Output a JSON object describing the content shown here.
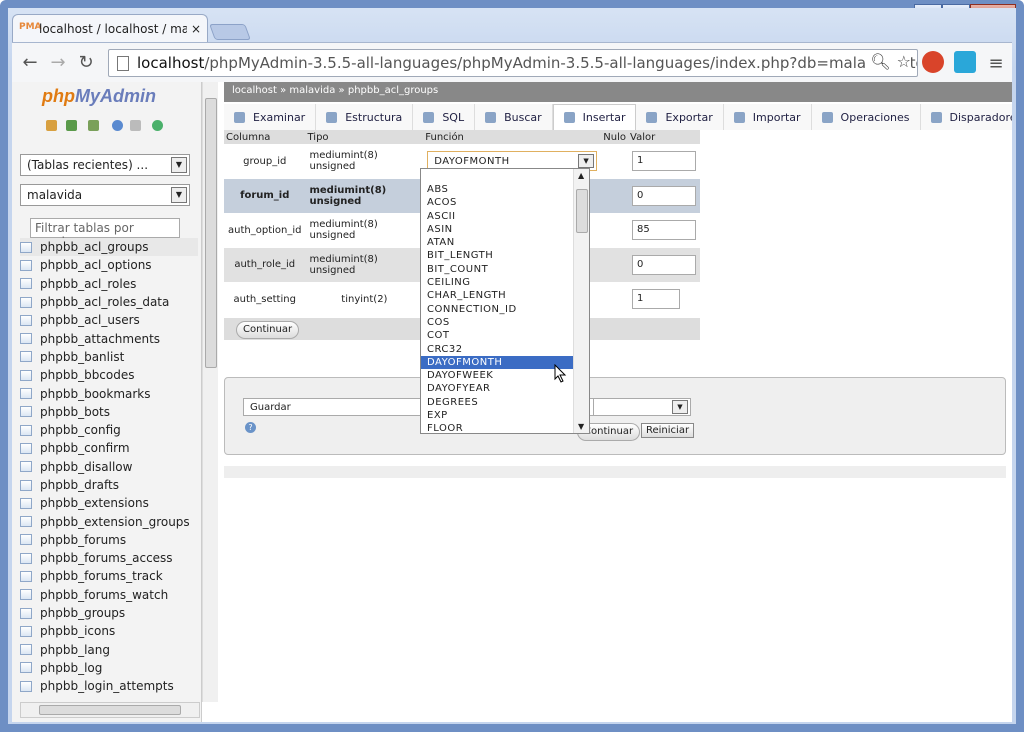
{
  "browser": {
    "tab_title": "localhost / localhost / mal",
    "tab_icon_text": "PMA",
    "close_glyph": "×",
    "url_host": "localhost",
    "url_path": "/phpMyAdmin-3.5.5-all-languages/phpMyAdmin-3.5.5-all-languages/index.php?db=malavida&tok",
    "caption_min": "‒",
    "caption_max": "□",
    "caption_close": "✕",
    "back": "←",
    "forward": "→",
    "reload": "↻",
    "zoom_icon": "🔍︎",
    "star_icon": "☆",
    "menu_icon": "≡"
  },
  "sidebar": {
    "logo_a": "php",
    "logo_b": "MyAdmin",
    "recent_select": "(Tablas recientes) ...",
    "db_select": "malavida",
    "filter_placeholder": "Filtrar tablas por nombre",
    "tables": [
      "phpbb_acl_groups",
      "phpbb_acl_options",
      "phpbb_acl_roles",
      "phpbb_acl_roles_data",
      "phpbb_acl_users",
      "phpbb_attachments",
      "phpbb_banlist",
      "phpbb_bbcodes",
      "phpbb_bookmarks",
      "phpbb_bots",
      "phpbb_config",
      "phpbb_confirm",
      "phpbb_disallow",
      "phpbb_drafts",
      "phpbb_extensions",
      "phpbb_extension_groups",
      "phpbb_forums",
      "phpbb_forums_access",
      "phpbb_forums_track",
      "phpbb_forums_watch",
      "phpbb_groups",
      "phpbb_icons",
      "phpbb_lang",
      "phpbb_log",
      "phpbb_login_attempts"
    ]
  },
  "breadcrumb": {
    "server": "localhost",
    "db": "malavida",
    "table": "phpbb_acl_groups",
    "sep": "»"
  },
  "tabs": [
    "Examinar",
    "Estructura",
    "SQL",
    "Buscar",
    "Insertar",
    "Exportar",
    "Importar",
    "Operaciones",
    "Disparadores"
  ],
  "insert_table": {
    "headers": {
      "col": "Columna",
      "type": "Tipo",
      "func": "Función",
      "null": "Nulo",
      "value": "Valor"
    },
    "rows": [
      {
        "name": "group_id",
        "type": "mediumint(8) unsigned",
        "func": "DAYOFMONTH",
        "value": "1"
      },
      {
        "name": "forum_id",
        "type": "mediumint(8) unsigned",
        "func": "",
        "value": "0"
      },
      {
        "name": "auth_option_id",
        "type": "mediumint(8) unsigned",
        "func": "",
        "value": "85"
      },
      {
        "name": "auth_role_id",
        "type": "mediumint(8) unsigned",
        "func": "",
        "value": "0"
      },
      {
        "name": "auth_setting",
        "type": "tinyint(2)",
        "func": "",
        "value": "1"
      }
    ],
    "continue_label": "Continuar"
  },
  "function_options": [
    "ABS",
    "ACOS",
    "ASCII",
    "ASIN",
    "ATAN",
    "BIT_LENGTH",
    "BIT_COUNT",
    "CEILING",
    "CHAR_LENGTH",
    "CONNECTION_ID",
    "COS",
    "COT",
    "CRC32",
    "DAYOFMONTH",
    "DAYOFWEEK",
    "DAYOFYEAR",
    "DEGREES",
    "EXP",
    "FLOOR"
  ],
  "function_selected": "DAYOFMONTH",
  "bottom": {
    "action_select": "Guardar",
    "continue_label": "Continuar",
    "reset_label": "Reiniciar",
    "help_glyph": "?"
  },
  "colors": {
    "accent": "#3b6cc4",
    "logo_orange": "#e07b12",
    "logo_blue": "#6a7dbb"
  }
}
